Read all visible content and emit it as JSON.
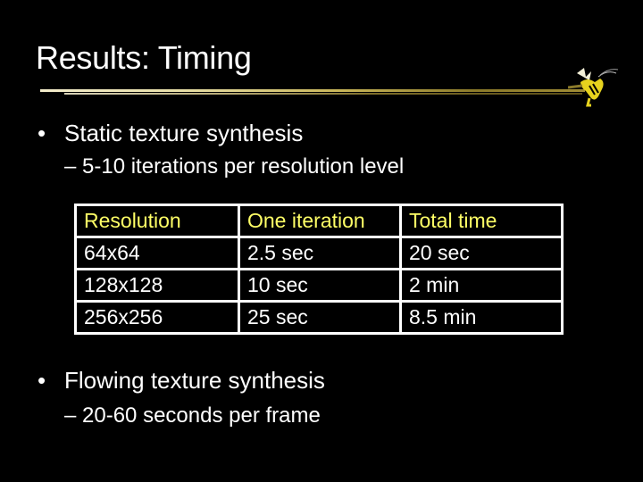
{
  "slide": {
    "title": "Results: Timing",
    "logo_icon": "yellow-jacket-mascot-icon",
    "bullets": [
      {
        "marker": "•",
        "text": "Static texture synthesis",
        "sub": {
          "marker": "–",
          "text": "– 5-10 iterations per resolution level"
        }
      },
      {
        "marker": "•",
        "text": "Flowing texture synthesis",
        "sub": {
          "marker": "–",
          "text": "– 20-60 seconds per frame"
        }
      }
    ],
    "table": {
      "headers": [
        "Resolution",
        "One iteration",
        "Total time"
      ],
      "rows": [
        [
          "64x64",
          "2.5 sec",
          "20 sec"
        ],
        [
          "128x128",
          "10 sec",
          "2 min"
        ],
        [
          "256x256",
          "25 sec",
          "8.5 min"
        ]
      ],
      "header_color": "#ffff66",
      "text_color": "#ffffff"
    },
    "colors": {
      "background": "#000000",
      "rule_gold": "#c9b659"
    }
  }
}
